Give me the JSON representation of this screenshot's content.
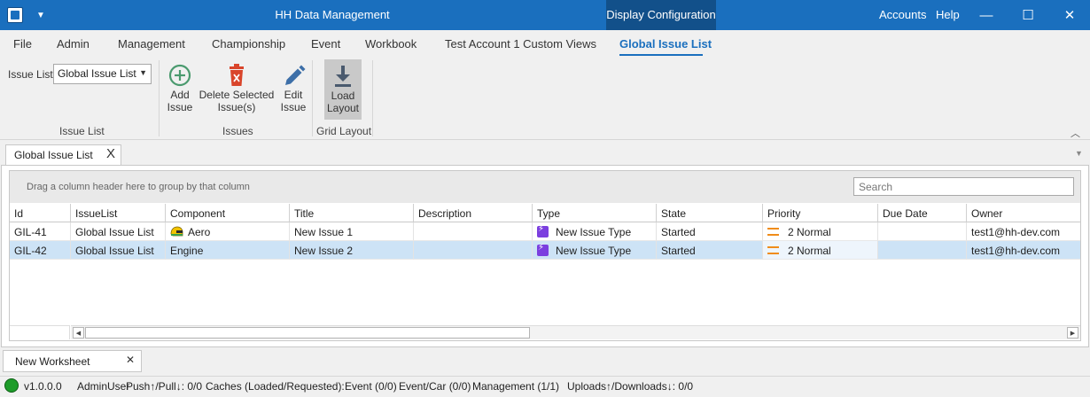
{
  "window": {
    "title": "HH Data Management",
    "context_tab": "Display Configuration",
    "accounts": "Accounts",
    "help": "Help",
    "close_glyph": "✕",
    "max_glyph": "☐",
    "min_glyph": "—",
    "quick_access_glyph": "▼"
  },
  "menu": {
    "tabs": [
      "File",
      "Admin",
      "Management",
      "Championship",
      "Event",
      "Workbook",
      "Test Account 1 Custom Views",
      "Global Issue List"
    ],
    "active_tab": "Global Issue List"
  },
  "ribbon": {
    "issue_list_label": "Issue List",
    "issue_list_value": "Global Issue List",
    "groups": {
      "issue_list": "Issue List",
      "issues": "Issues",
      "grid_layout": "Grid Layout"
    },
    "buttons": {
      "add_line1": "Add",
      "add_line2": "Issue",
      "delete_line1": "Delete Selected",
      "delete_line2": "Issue(s)",
      "edit_line1": "Edit",
      "edit_line2": "Issue",
      "load_line1": "Load",
      "load_line2": "Layout"
    }
  },
  "document": {
    "tab_label": "Global Issue List",
    "tab_close": "X"
  },
  "grid": {
    "group_hint": "Drag a column header here to group by that column",
    "search_placeholder": "Search",
    "columns": [
      "Id",
      "IssueList",
      "Component",
      "Title",
      "Description",
      "Type",
      "State",
      "Priority",
      "Due Date",
      "Owner"
    ],
    "rows": [
      {
        "id": "GIL-41",
        "issue_list": "Global Issue List",
        "component": "Aero",
        "title": "New Issue 1",
        "description": "",
        "type": "New Issue Type",
        "state": "Started",
        "priority": "2 Normal",
        "due_date": "",
        "owner": "test1@hh-dev.com",
        "selected": false
      },
      {
        "id": "GIL-42",
        "issue_list": "Global Issue List",
        "component": "Engine",
        "title": "New Issue 2",
        "description": "",
        "type": "New Issue Type",
        "state": "Started",
        "priority": "2 Normal",
        "due_date": "",
        "owner": "test1@hh-dev.com",
        "selected": true
      }
    ]
  },
  "worksheets": {
    "tab_label": "New Worksheet",
    "close_glyph": "✕"
  },
  "status": {
    "indicator_color": "#1e9c2a",
    "version": "v1.0.0.0",
    "user": "AdminUser",
    "push_pull": "Push↑/Pull↓: 0/0",
    "caches": "Caches (Loaded/Requested):",
    "event": "Event (0/0)",
    "event_car": "Event/Car (0/0)",
    "management": "Management (1/1)",
    "uploads": "Uploads↑/Downloads↓: 0/0"
  },
  "colors": {
    "accent": "#1a6fbe",
    "selection": "#cde3f6",
    "type_icon": "#7b3fdf",
    "priority_icon": "#f08c1a",
    "delete_icon": "#d9452b"
  }
}
